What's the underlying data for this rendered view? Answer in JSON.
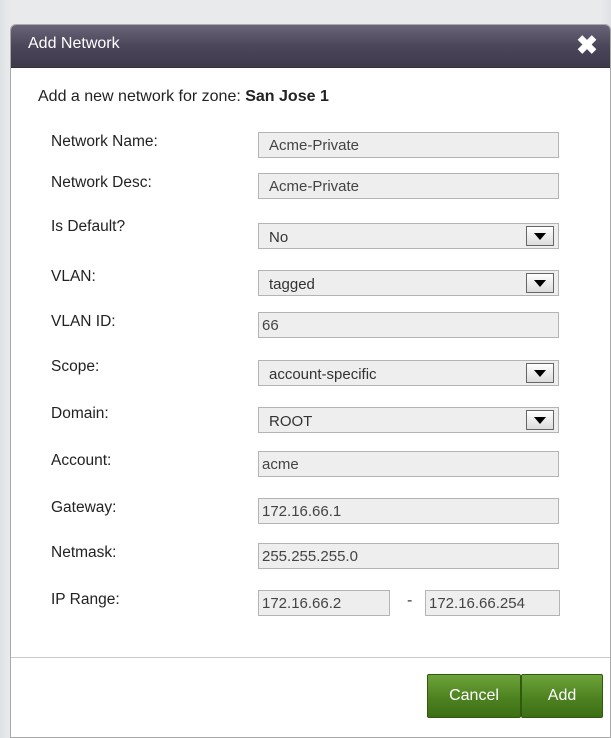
{
  "dialog": {
    "title": "Add Network",
    "close_symbol": "✖"
  },
  "subtitle": {
    "prefix": "Add a new network for zone: ",
    "zone": "San Jose 1"
  },
  "form": {
    "network_name": {
      "label": "Network Name:",
      "value": "Acme-Private"
    },
    "network_desc": {
      "label": "Network Desc:",
      "value": "Acme-Private"
    },
    "is_default": {
      "label": "Is Default?",
      "value": "No"
    },
    "vlan": {
      "label": "VLAN:",
      "value": "tagged"
    },
    "vlan_id": {
      "label": "VLAN ID:",
      "value": "66"
    },
    "scope": {
      "label": "Scope:",
      "value": "account-specific"
    },
    "domain": {
      "label": "Domain:",
      "value": "ROOT"
    },
    "account": {
      "label": "Account:",
      "value": "acme"
    },
    "gateway": {
      "label": "Gateway:",
      "value": "172.16.66.1"
    },
    "netmask": {
      "label": "Netmask:",
      "value": "255.255.255.0"
    },
    "ip_range": {
      "label": "IP Range:",
      "start": "172.16.66.2",
      "separator": "-",
      "end": "172.16.66.254"
    }
  },
  "buttons": {
    "cancel": "Cancel",
    "add": "Add"
  },
  "colors": {
    "titlebar": "#4c465b",
    "button_green": "#4d8220"
  }
}
